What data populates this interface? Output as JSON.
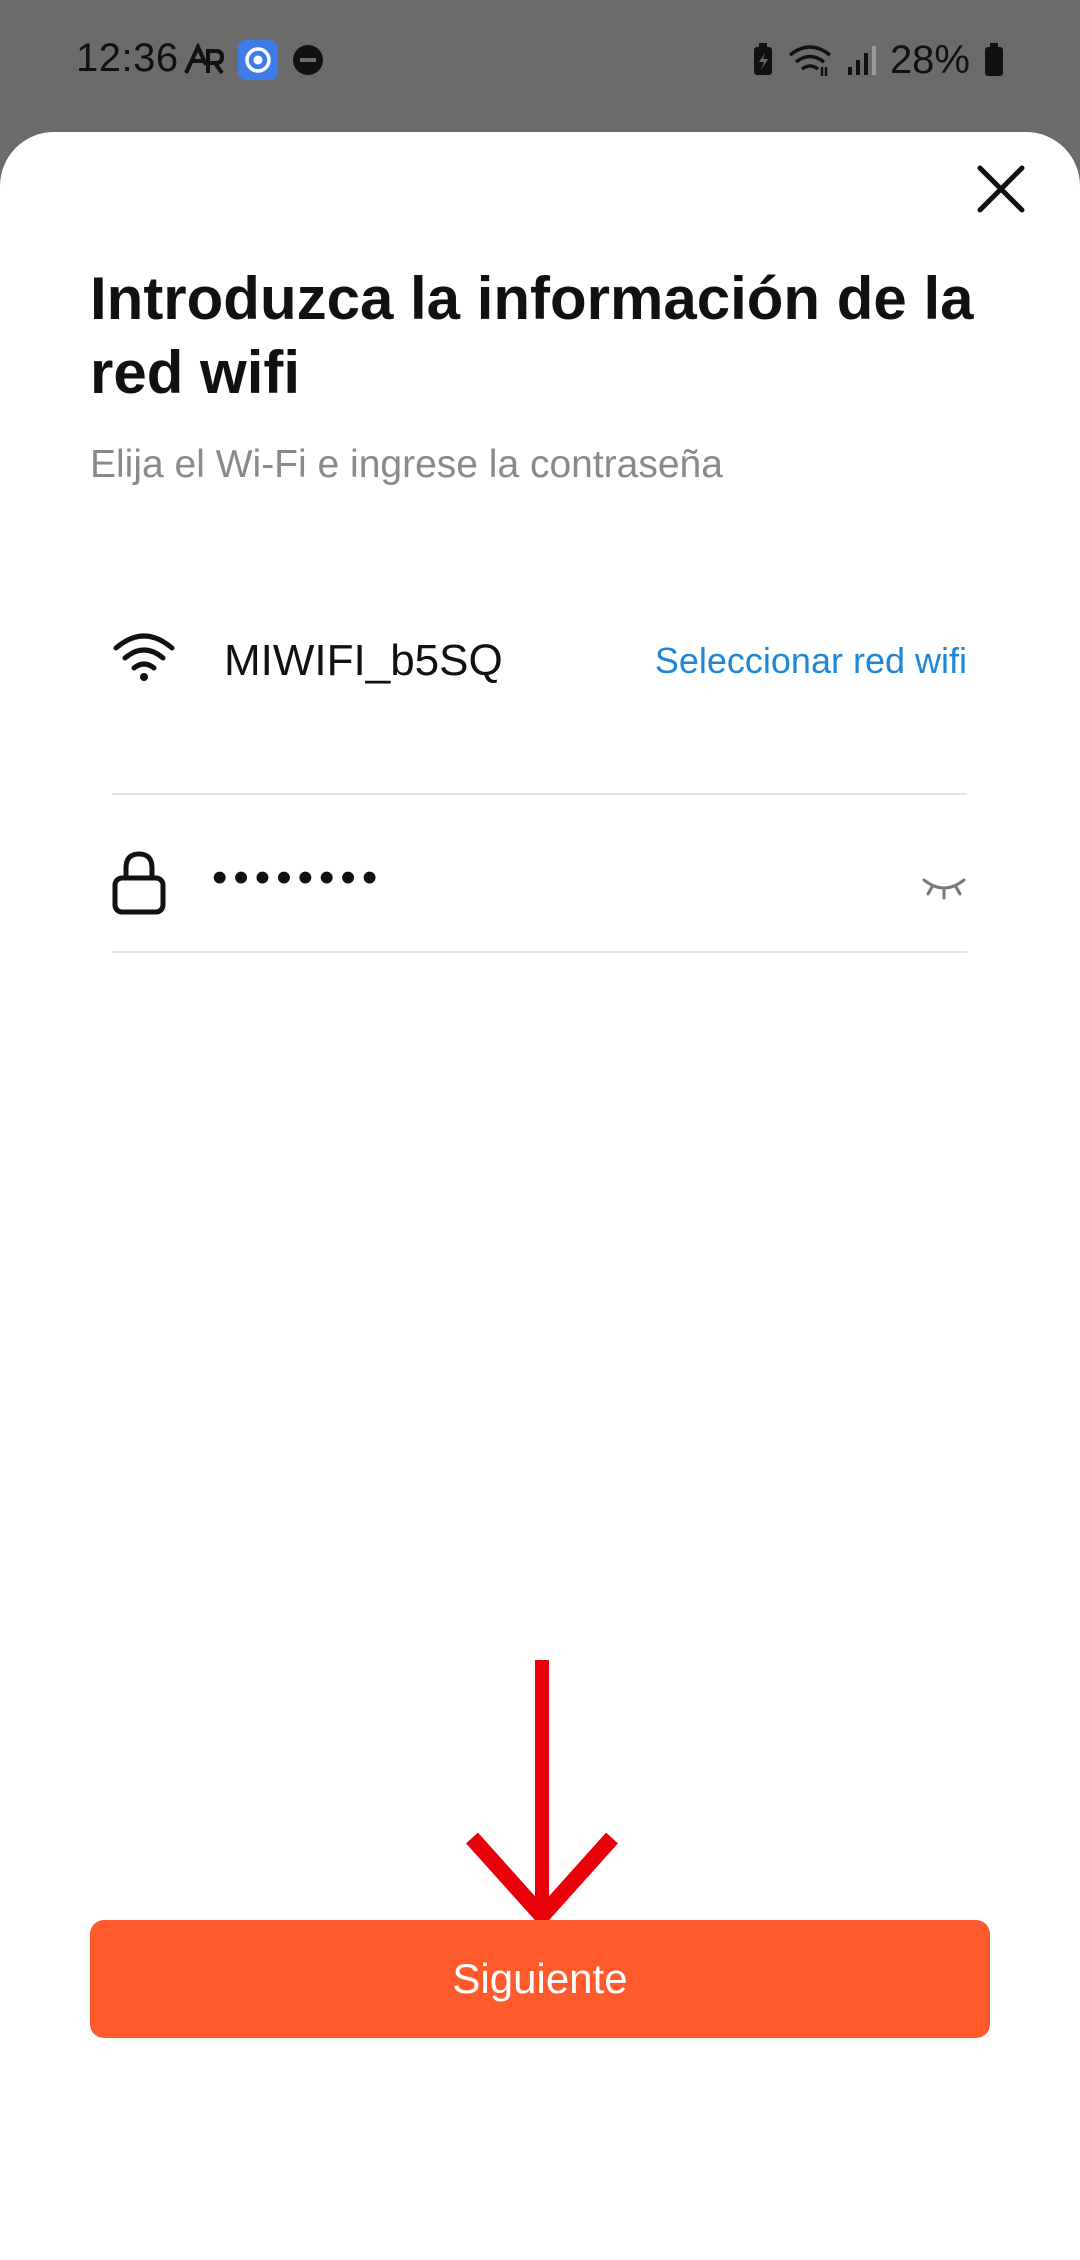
{
  "status_bar": {
    "time": "12:36",
    "battery": "28%",
    "left_icons": [
      "ar-icon",
      "app-notification-icon",
      "do-not-disturb-icon"
    ],
    "right_icons": [
      "battery-saver-icon",
      "wifi-signal-icon",
      "cell-signal-icon",
      "battery-icon"
    ]
  },
  "sheet": {
    "title": "Introduzca la información de la red wifi",
    "subtitle": "Elija el Wi-Fi e ingrese la contraseña",
    "wifi": {
      "name": "MIWIFI_b5SQ",
      "select_label": "Seleccionar red wifi"
    },
    "password": {
      "value": "••••••••"
    },
    "next_label": "Siguiente"
  },
  "colors": {
    "accent": "#ff5a2c",
    "link": "#1f87d6",
    "annotation_arrow": "#e8000b"
  }
}
